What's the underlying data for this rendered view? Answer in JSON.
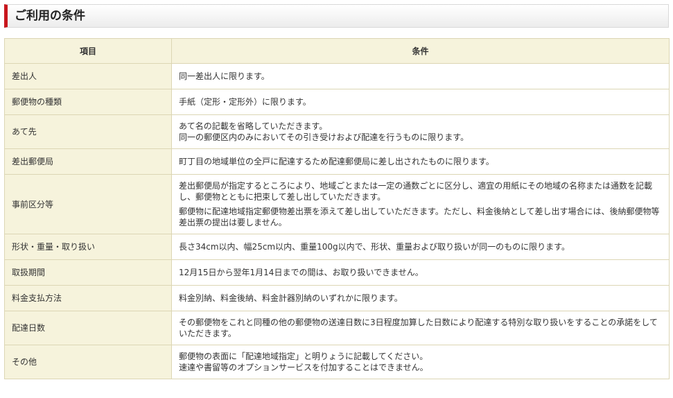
{
  "section": {
    "title": "ご利用の条件"
  },
  "table": {
    "headers": {
      "item": "項目",
      "condition": "条件"
    },
    "rows": [
      {
        "item": "差出人",
        "lines": [
          "同一差出人に限ります。"
        ]
      },
      {
        "item": "郵便物の種類",
        "lines": [
          "手紙（定形・定形外）に限ります。"
        ]
      },
      {
        "item": "あて先",
        "lines": [
          "あて名の記載を省略していただきます。",
          "同一の郵便区内のみにおいてその引き受けおよび配達を行うものに限ります。"
        ]
      },
      {
        "item": "差出郵便局",
        "lines": [
          "町丁目の地域単位の全戸に配達するため配達郵便局に差し出されたものに限ります。"
        ]
      },
      {
        "item": "事前区分等",
        "paragraphs": [
          "差出郵便局が指定するところにより、地域ごとまたは一定の通数ごとに区分し、適宜の用紙にその地域の名称または通数を記載し、郵便物とともに把束して差し出していただきます。",
          "郵便物に配達地域指定郵便物差出票を添えて差し出していただきます。ただし、料金後納として差し出す場合には、後納郵便物等差出票の提出は要しません。"
        ]
      },
      {
        "item": "形状・重量・取り扱い",
        "lines": [
          "長さ34cm以内、幅25cm以内、重量100g以内で、形状、重量および取り扱いが同一のものに限ります。"
        ]
      },
      {
        "item": "取扱期間",
        "lines": [
          "12月15日から翌年1月14日までの間は、お取り扱いできません。"
        ]
      },
      {
        "item": "料金支払方法",
        "lines": [
          "料金別納、料金後納、料金計器別納のいずれかに限ります。"
        ]
      },
      {
        "item": "配達日数",
        "paragraphs": [
          "その郵便物をこれと同種の他の郵便物の送達日数に3日程度加算した日数により配達する特別な取り扱いをすることの承諾をしていただきます。"
        ]
      },
      {
        "item": "その他",
        "lines": [
          "郵便物の表面に「配達地域指定」と明りょうに記載してください。",
          "速達や書留等のオプションサービスを付加することはできません。"
        ]
      }
    ]
  }
}
